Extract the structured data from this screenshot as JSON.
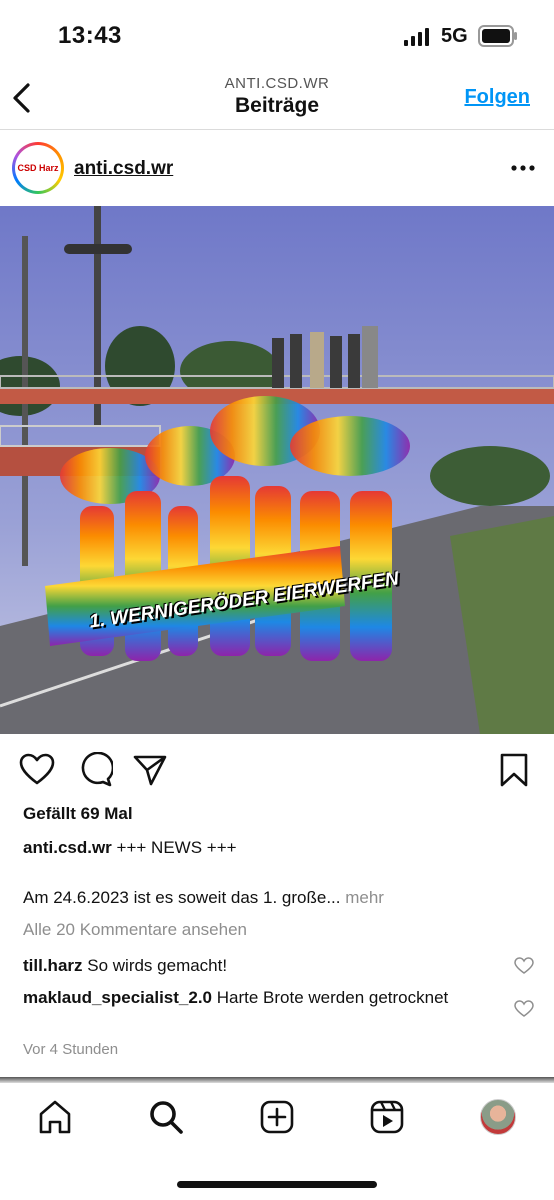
{
  "status": {
    "time": "13:43",
    "network": "5G"
  },
  "header": {
    "subtitle": "ANTI.CSD.WR",
    "title": "Beiträge",
    "follow_label": "Folgen"
  },
  "post": {
    "username": "anti.csd.wr",
    "avatar_text": "CSD Harz",
    "image_banner": "1. WERNIGERÖDER EIERWERFEN",
    "likes": "Gefällt 69 Mal",
    "caption_user": "anti.csd.wr",
    "caption_title": "+++ NEWS +++",
    "caption_body": "Am 24.6.2023 ist es soweit das 1. große...",
    "caption_more": "mehr",
    "view_comments": "Alle 20 Kommentare ansehen",
    "comments": [
      {
        "user": "till.harz",
        "text": "So wirds gemacht!"
      },
      {
        "user": "maklaud_specialist_2.0",
        "text": "Harte Brote werden getrocknet"
      }
    ],
    "timestamp": "Vor 4 Stunden"
  },
  "icons": {
    "back": "chevron-left-icon",
    "more": "more-horizontal-icon",
    "like": "heart-icon",
    "comment": "comment-icon",
    "share": "send-icon",
    "save": "bookmark-icon",
    "tabs": [
      "home-icon",
      "search-icon",
      "create-icon",
      "reels-icon",
      "profile-avatar"
    ]
  },
  "colors": {
    "accent": "#0095f6",
    "muted": "#8e8e8e",
    "divider": "#dbdbdb"
  }
}
